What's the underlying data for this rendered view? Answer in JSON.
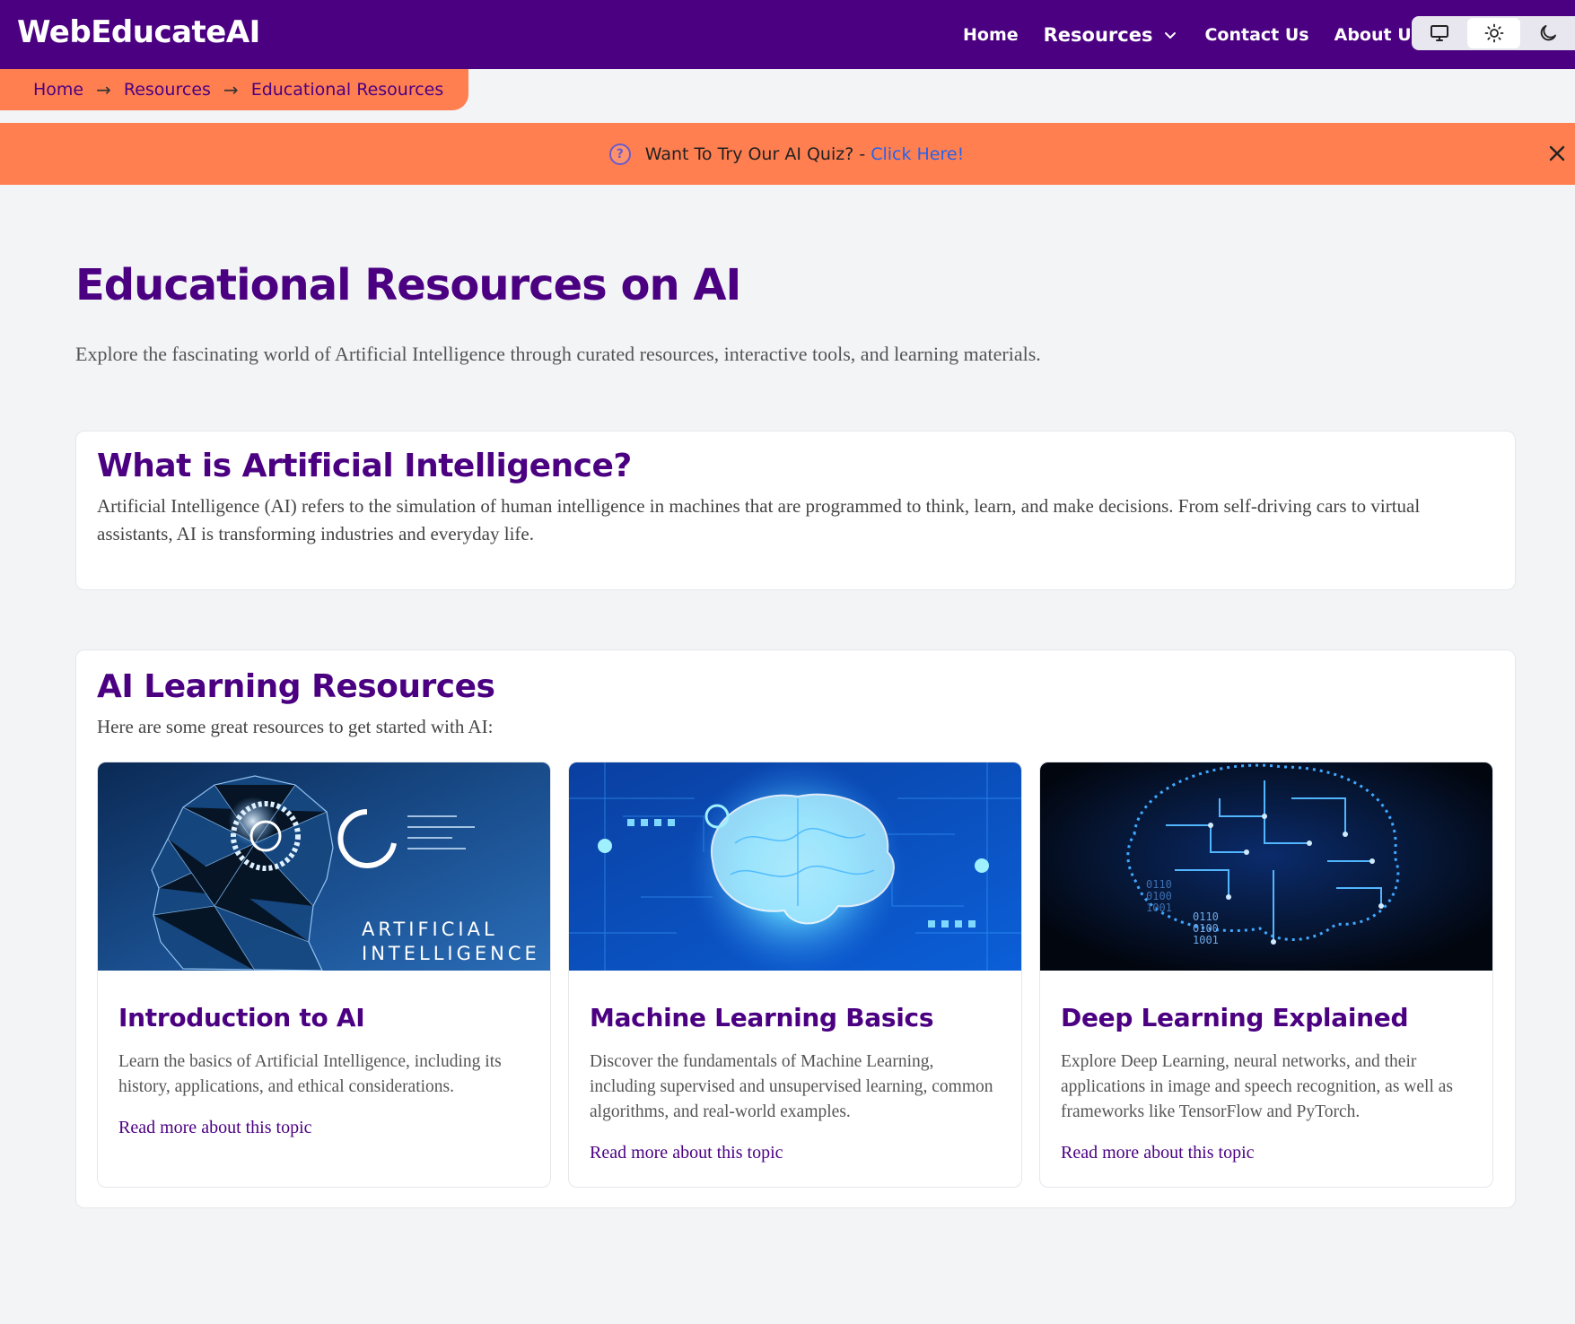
{
  "brand": {
    "name": "WebEducateAI"
  },
  "nav": {
    "items": [
      {
        "label": "Home"
      },
      {
        "label": "Resources"
      },
      {
        "label": "Contact Us"
      },
      {
        "label": "About Us"
      }
    ],
    "theme_options": [
      "monitor-icon",
      "sun-icon",
      "moon-icon"
    ],
    "active_theme": "sun-icon"
  },
  "breadcrumb": {
    "items": [
      "Home",
      "Resources",
      "Educational Resources"
    ],
    "separator": "→"
  },
  "banner": {
    "text": "Want To Try Our AI Quiz? -",
    "link": "Click Here!",
    "icon": "question-circle-icon",
    "close_icon": "close-icon"
  },
  "page": {
    "title": "Educational Resources on AI",
    "subtitle": "Explore the fascinating world of Artificial Intelligence through curated resources, interactive tools, and learning materials."
  },
  "what_is_ai": {
    "title": "What is Artificial Intelligence?",
    "body": "Artificial Intelligence (AI) refers to the simulation of human intelligence in machines that are programmed to think, learn, and make decisions. From self-driving cars to virtual assistants, AI is transforming industries and everyday life."
  },
  "resources": {
    "title": "AI Learning Resources",
    "intro": "Here are some great resources to get started with AI:",
    "cards": [
      {
        "title": "Introduction to AI",
        "description": "Learn the basics of Artificial Intelligence, including its history, applications, and ethical considerations.",
        "link": "Read more about this topic",
        "image_caption": [
          "ARTIFICIAL",
          "INTELLIGENCE"
        ]
      },
      {
        "title": "Machine Learning Basics",
        "description": "Discover the fundamentals of Machine Learning, including supervised and unsupervised learning, common algorithms, and real-world examples.",
        "link": "Read more about this topic"
      },
      {
        "title": "Deep Learning Explained",
        "description": "Explore Deep Learning, neural networks, and their applications in image and speech recognition, as well as frameworks like TensorFlow and PyTorch.",
        "link": "Read more about this topic",
        "image_binary": [
          "0110",
          "0100",
          "1001",
          "0110",
          "0100",
          "1001"
        ]
      }
    ]
  },
  "colors": {
    "primary": "#4b0082",
    "accent": "#ff7f50",
    "link": "#2563eb",
    "background": "#f3f4f6"
  }
}
